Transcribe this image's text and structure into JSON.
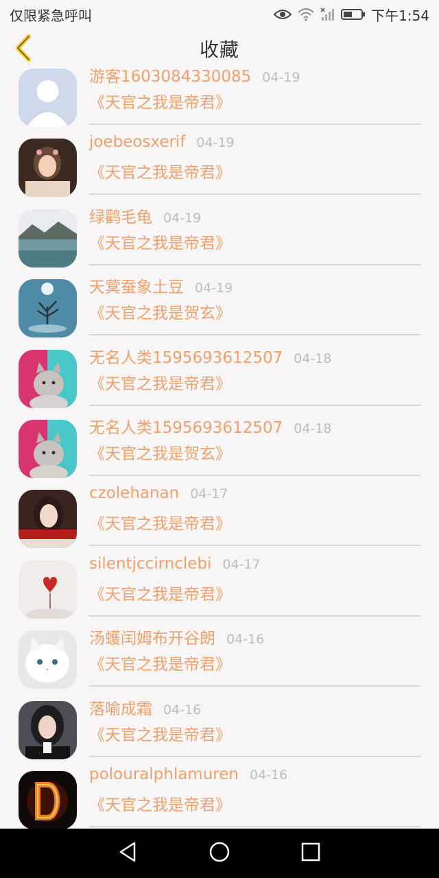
{
  "status_bar": {
    "left_text": "仅限紧急呼叫",
    "time": "下午1:54"
  },
  "header": {
    "title": "收藏"
  },
  "colors": {
    "accent": "#f0a06a",
    "back_icon": "#f2c21d",
    "date": "#bdbdbd"
  },
  "favorites": [
    {
      "name": "游客1603084330085",
      "date": "04-19",
      "book": "《天官之我是帝君》"
    },
    {
      "name": "joebeosxerif",
      "date": "04-19",
      "book": "《天官之我是帝君》"
    },
    {
      "name": "绿鹳毛龟",
      "date": "04-19",
      "book": "《天官之我是帝君》"
    },
    {
      "name": "天蓂蚕象土豆",
      "date": "04-19",
      "book": "《天官之我是贺玄》"
    },
    {
      "name": "无名人类1595693612507",
      "date": "04-18",
      "book": "《天官之我是帝君》"
    },
    {
      "name": "无名人类1595693612507",
      "date": "04-18",
      "book": "《天官之我是贺玄》"
    },
    {
      "name": "czolehanan",
      "date": "04-17",
      "book": "《天官之我是帝君》"
    },
    {
      "name": "silentjccirnclebi",
      "date": "04-17",
      "book": "《天官之我是帝君》"
    },
    {
      "name": "汤蠖闰姆布开谷朗",
      "date": "04-16",
      "book": "《天官之我是帝君》"
    },
    {
      "name": "落喻成霜",
      "date": "04-16",
      "book": "《天官之我是帝君》"
    },
    {
      "name": "polouralphlamuren",
      "date": "04-16",
      "book": "《天官之我是帝君》"
    }
  ]
}
